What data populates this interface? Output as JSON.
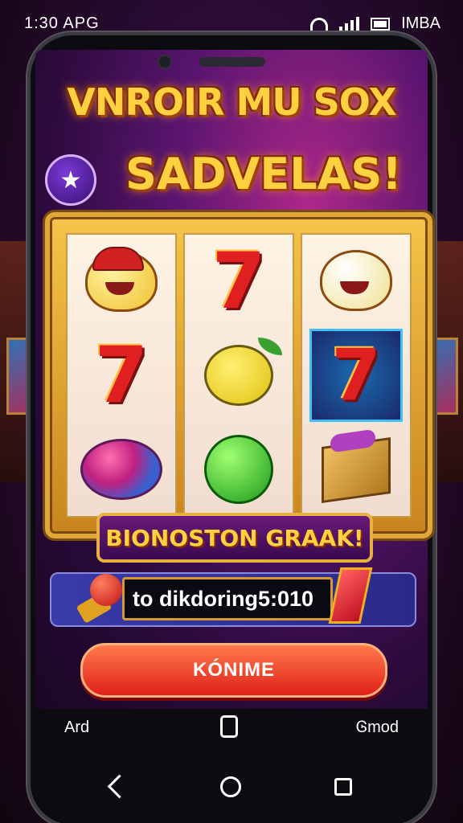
{
  "status_bar": {
    "time": "1:30",
    "carrier": "APG",
    "right_label": "IMBA"
  },
  "header": {
    "title_line1": "VNROIR MU SOX",
    "title_line2": "SADVELAS!"
  },
  "reels": {
    "columns": [
      [
        "clown-face",
        "seven",
        "beetle"
      ],
      [
        "seven",
        "lime-face",
        "green-ball"
      ],
      [
        "cream-face",
        "seven",
        "gift-box"
      ]
    ],
    "highlighted_cell": "reel-3-row-2"
  },
  "banner": {
    "text": "BIONOSTON GRAAK!"
  },
  "info": {
    "text": "to dikdoring5:010"
  },
  "cta": {
    "label": "KÓNIME"
  },
  "bottom_tabs": {
    "left": "Ard",
    "right": "Ꮆmod"
  },
  "icons": [
    "star-icon",
    "back-icon",
    "home-icon",
    "recent-apps-icon",
    "wifi-icon",
    "signal-icon",
    "battery-icon"
  ],
  "colors": {
    "accent_gold": "#ffd040",
    "cta_red": "#e0201a",
    "bg_purple": "#5a1570"
  }
}
